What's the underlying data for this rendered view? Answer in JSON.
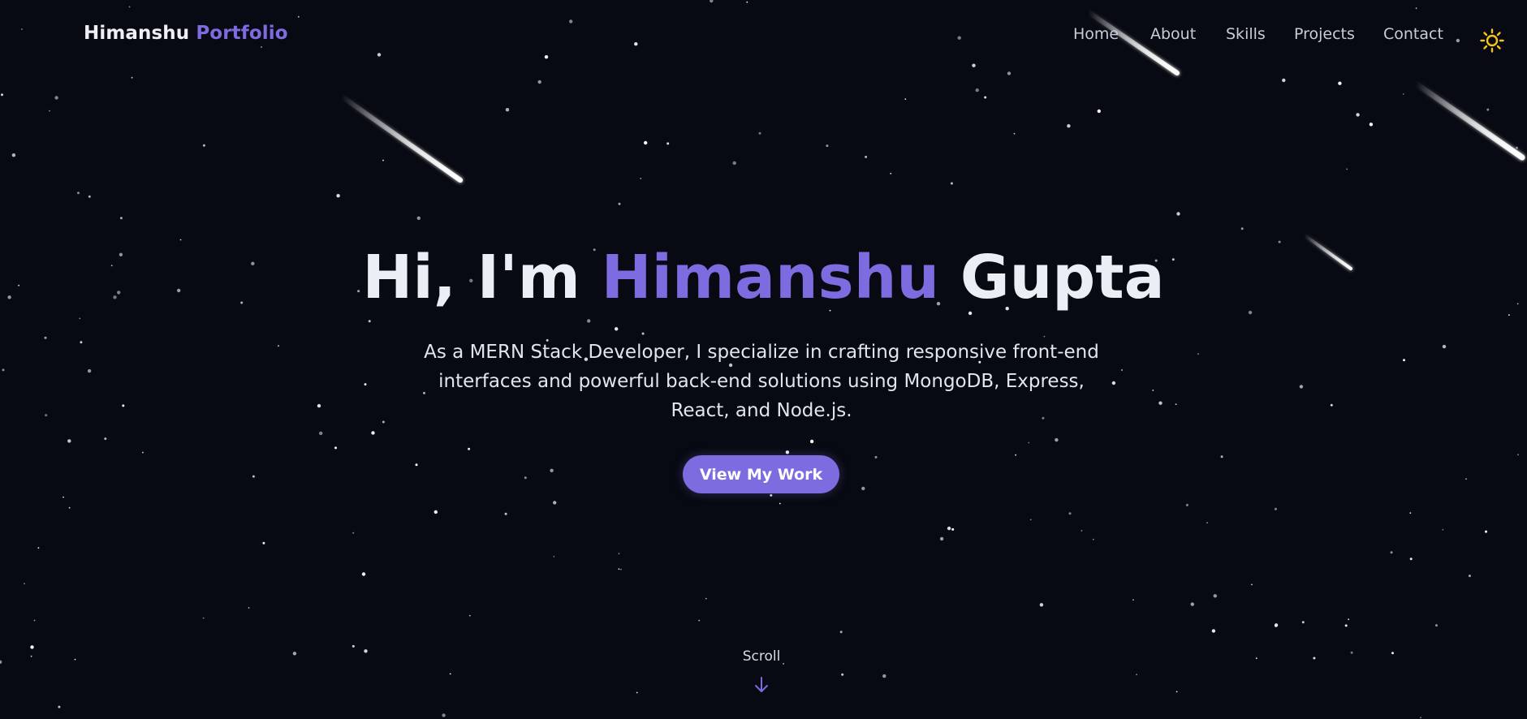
{
  "nav": {
    "brand_first": "Himanshu",
    "brand_second": "Portfolio",
    "links": [
      "Home",
      "About",
      "Skills",
      "Projects",
      "Contact"
    ],
    "theme_icon": "sun-icon"
  },
  "hero": {
    "greeting": "Hi, I'm",
    "first_name": "Himanshu",
    "last_name": "Gupta",
    "description": "As a MERN Stack Developer, I specialize in crafting responsive front-end interfaces and powerful back-end solutions using MongoDB, Express, React, and Node.js.",
    "cta_label": "View My Work",
    "scroll_label": "Scroll",
    "scroll_icon": "arrow-down-icon"
  },
  "colors": {
    "background": "#070a12",
    "accent": "#7c6ce0",
    "text": "#eceef5",
    "sun": "#f5c518"
  }
}
